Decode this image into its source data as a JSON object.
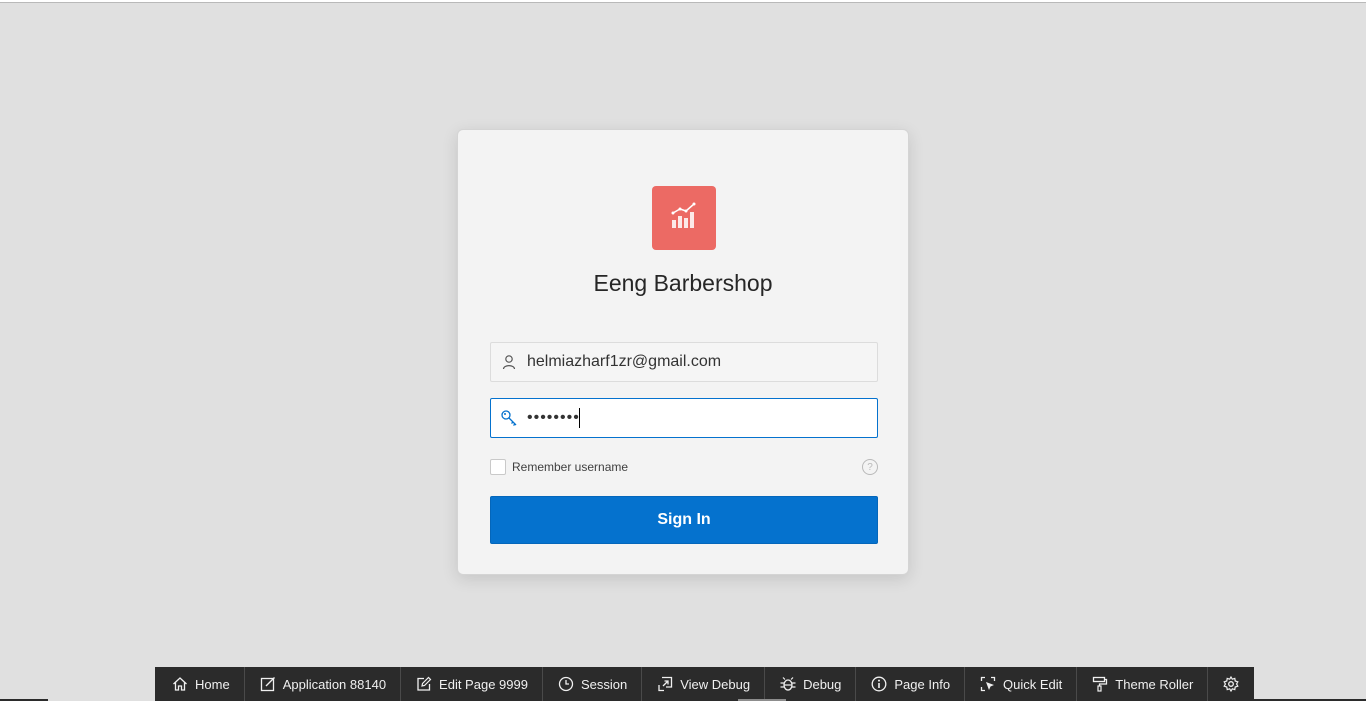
{
  "app": {
    "title": "Eeng Barbershop",
    "icon": "chart-line-icon",
    "icon_color": "#ec6a64"
  },
  "login": {
    "username_value": "helmiazharf1zr@gmail.com",
    "username_icon": "user-icon",
    "password_value": "••••••••",
    "password_icon": "key-icon",
    "remember_label": "Remember username",
    "remember_checked": false,
    "help_icon": "help-icon",
    "signin_label": "Sign In",
    "accent_color": "#0572ce"
  },
  "dev_toolbar": {
    "items": [
      {
        "label": "Home",
        "icon": "home-icon"
      },
      {
        "label": "Application 88140",
        "icon": "edit-app-icon"
      },
      {
        "label": "Edit Page 9999",
        "icon": "edit-page-icon"
      },
      {
        "label": "Session",
        "icon": "clock-icon"
      },
      {
        "label": "View Debug",
        "icon": "view-debug-icon"
      },
      {
        "label": "Debug",
        "icon": "bug-icon"
      },
      {
        "label": "Page Info",
        "icon": "info-icon"
      },
      {
        "label": "Quick Edit",
        "icon": "quick-edit-icon"
      },
      {
        "label": "Theme Roller",
        "icon": "paint-roller-icon"
      }
    ],
    "settings_icon": "gear-icon"
  }
}
